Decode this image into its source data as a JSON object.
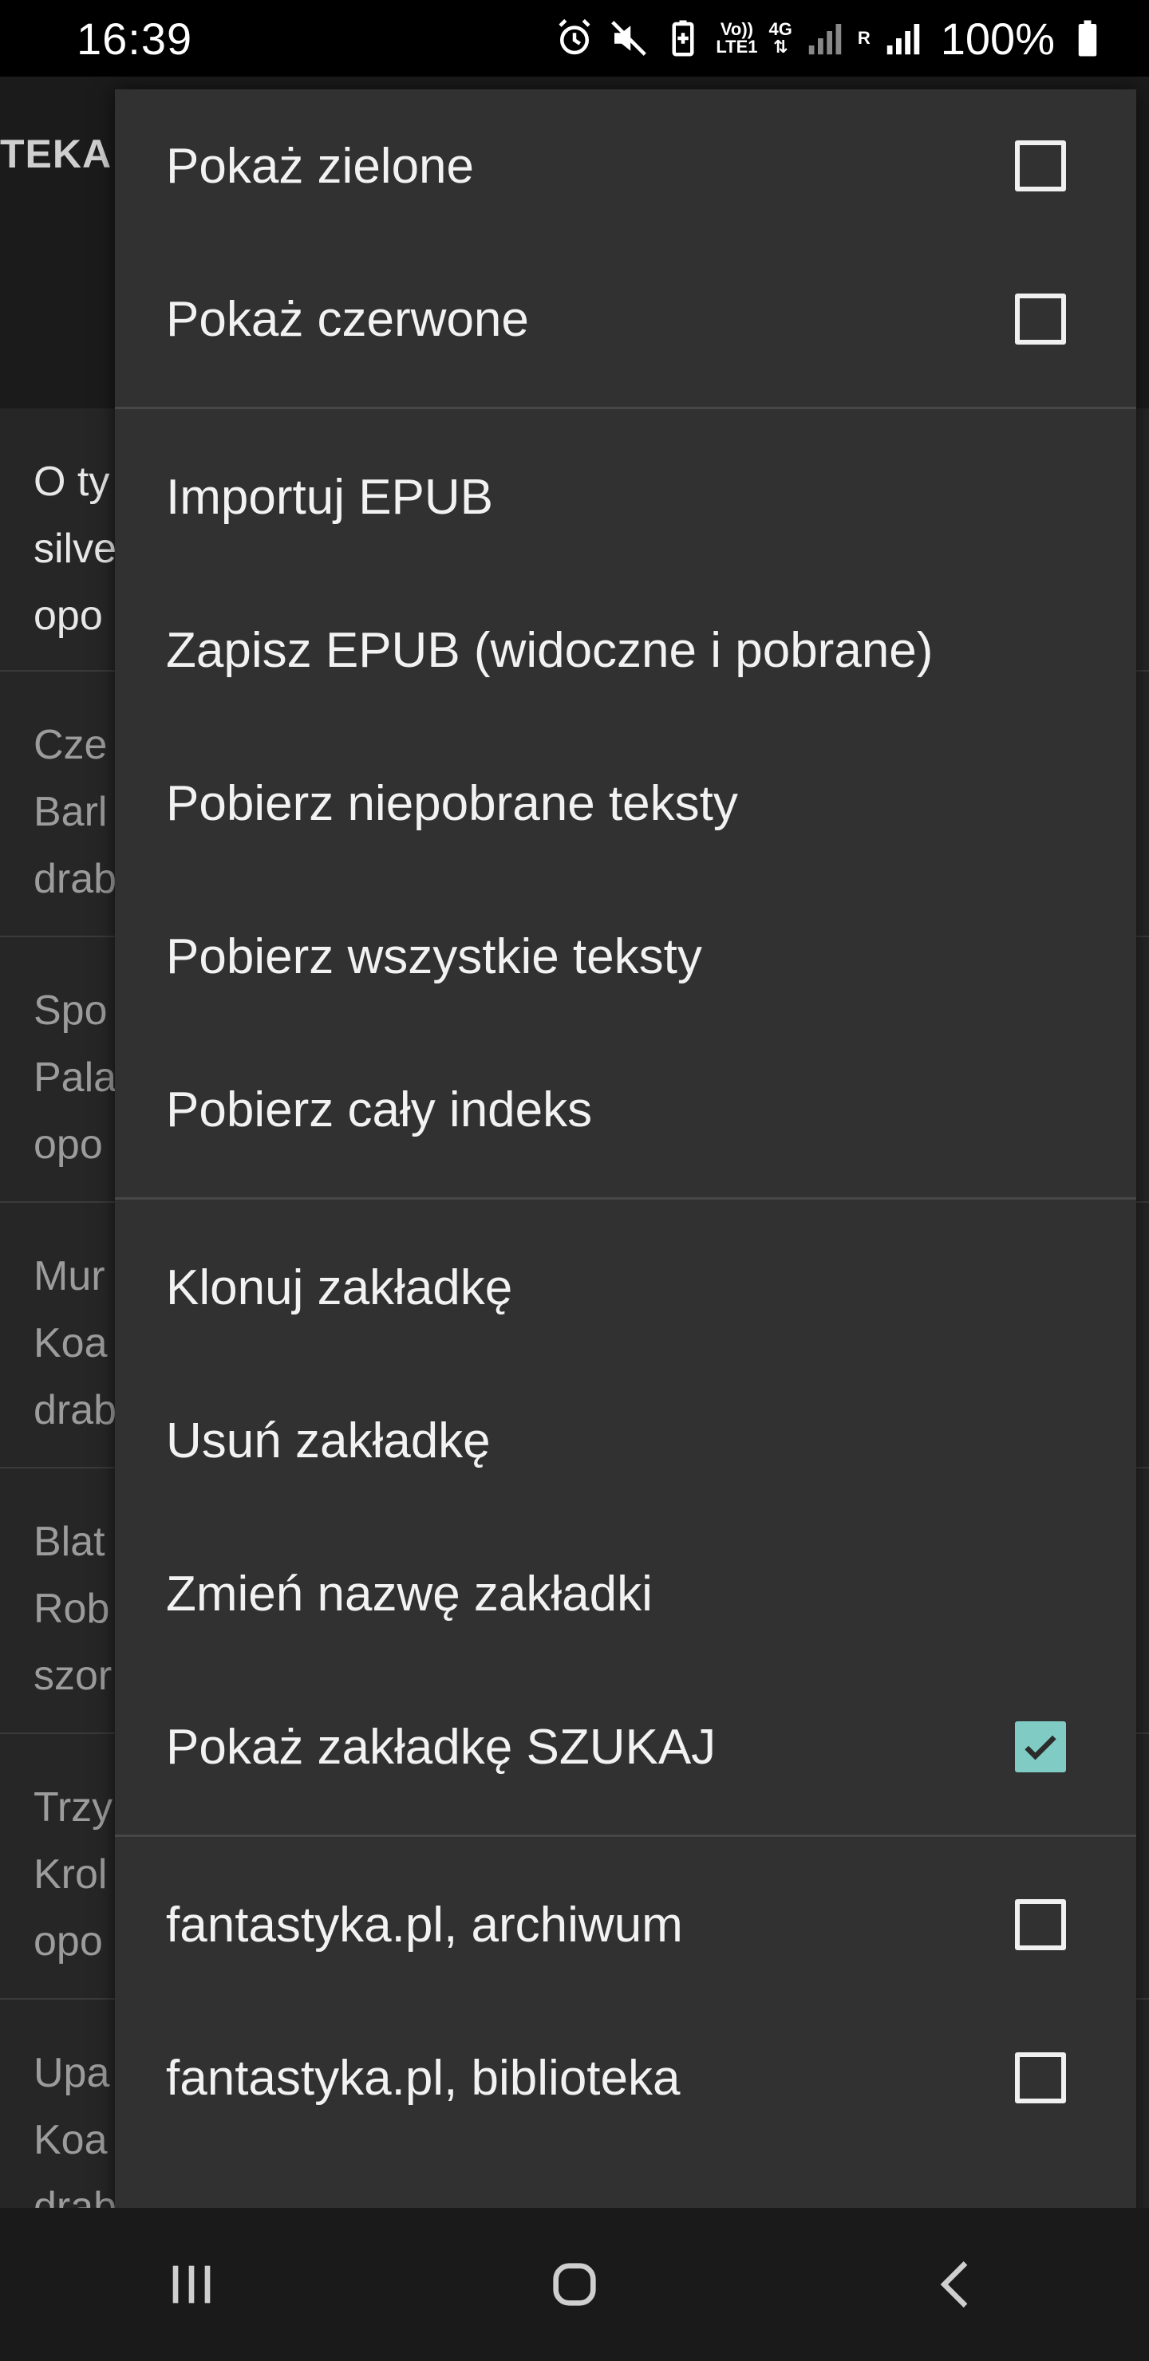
{
  "status_bar": {
    "time": "16:39",
    "volte_label_top": "Vo))",
    "volte_label_bottom": "LTE1",
    "network_label": "4G",
    "roaming_label": "R",
    "battery_percent": "100%",
    "icons": [
      "alarm-icon",
      "mute-icon",
      "battery-saver-icon",
      "signal-icon",
      "signal-icon",
      "battery-icon"
    ]
  },
  "background": {
    "tab_fragment": "TEKA",
    "items": [
      {
        "lines": [
          "O ty",
          "silve",
          "opo"
        ]
      },
      {
        "lines": [
          "Cze",
          "Barl",
          "drab"
        ]
      },
      {
        "lines": [
          "Spo",
          "Pala",
          "opo"
        ]
      },
      {
        "lines": [
          "Mur",
          "Koa",
          "drab"
        ]
      },
      {
        "lines": [
          "Blat",
          "Rob",
          "szor"
        ]
      },
      {
        "lines": [
          "Trzy",
          "Krol",
          "opo"
        ]
      },
      {
        "lines": [
          "Upa",
          "Koa",
          "drab"
        ]
      }
    ]
  },
  "menu": {
    "group1": [
      {
        "label": "Pokaż zielone",
        "checked": false
      },
      {
        "label": "Pokaż czerwone",
        "checked": false
      }
    ],
    "group2": [
      {
        "label": "Importuj EPUB"
      },
      {
        "label": "Zapisz EPUB (widoczne i pobrane)"
      },
      {
        "label": "Pobierz niepobrane teksty"
      },
      {
        "label": "Pobierz wszystkie teksty"
      },
      {
        "label": "Pobierz cały indeks"
      }
    ],
    "group3": [
      {
        "label": "Klonuj zakładkę"
      },
      {
        "label": "Usuń zakładkę"
      },
      {
        "label": "Zmień nazwę zakładki"
      },
      {
        "label": "Pokaż zakładkę SZUKAJ",
        "checked": true
      }
    ],
    "group4": [
      {
        "label": "fantastyka.pl, archiwum",
        "checked": false
      },
      {
        "label": "fantastyka.pl, biblioteka",
        "checked": false
      }
    ]
  },
  "nav_bar": {
    "icons": [
      "recent-apps-icon",
      "home-icon",
      "back-icon"
    ]
  },
  "colors": {
    "menu_background": "#313131",
    "checkbox_checked": "#80cbc4",
    "text": "#f2f2f2"
  }
}
